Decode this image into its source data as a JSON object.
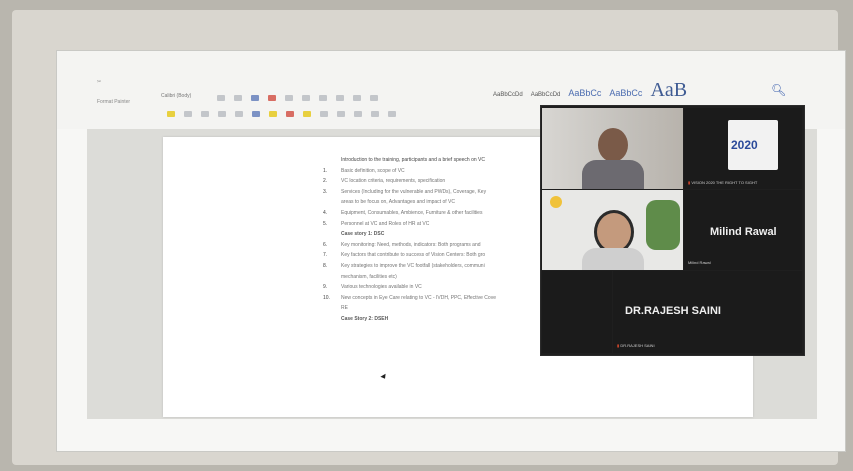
{
  "ribbon": {
    "font_name": "Calibri (Body)",
    "format_painter": "Format Painter",
    "style_gallery": [
      {
        "label": "AaBbCcDd",
        "variant": "normal"
      },
      {
        "label": "AaBbCcDd",
        "variant": "normal"
      },
      {
        "label": "AaBbCc",
        "variant": "blue"
      },
      {
        "label": "AaBbCc",
        "variant": "blue"
      },
      {
        "label": "AaB",
        "variant": "title"
      }
    ],
    "find_icon": "binoculars-icon"
  },
  "document": {
    "intro": "Introduction to the training, participants and a brief speech on VC",
    "items": [
      {
        "num": "1.",
        "text": "Basic definition, scope of VC"
      },
      {
        "num": "2.",
        "text": "VC location criteria, requirements, specification"
      },
      {
        "num": "3.",
        "text": "Services (Including for the vulnerable and PWDs), Coverage, Key"
      },
      {
        "num": "",
        "text": "areas to be focus on, Advantages and impact of VC"
      },
      {
        "num": "4.",
        "text": "Equipment, Consumables, Ambience, Furniture & other facilities"
      },
      {
        "num": "5.",
        "text": "Personnel at VC and Roles of HR at VC"
      },
      {
        "num": "",
        "text": "Case story 1: DSC",
        "bold": true
      },
      {
        "num": "6.",
        "text": "Key monitoring: Need, methods, indicators: Both programs and"
      },
      {
        "num": "7.",
        "text": "Key factors that contribute to success of Vision Centers: Both gro"
      },
      {
        "num": "8.",
        "text": "Key strategies to improve the VC footfall (stakeholders, communi"
      },
      {
        "num": "",
        "text": "mechanism, facilities etc)"
      },
      {
        "num": "9.",
        "text": "Various technologies available in VC"
      },
      {
        "num": "10.",
        "text": "New concepts in Eye Care relating to VC - IVDH, PPC, Effective Cove"
      },
      {
        "num": "",
        "text": "RE"
      },
      {
        "num": "",
        "text": "Case Story 2: DSEH",
        "bold": true
      }
    ]
  },
  "video_call": {
    "participant_1_label": "",
    "logo_tile_caption": "VISION 2020 THE RIGHT TO SIGHT",
    "logo_text": "2020",
    "participant_2_label": "",
    "milind_name": "Milind Rawal",
    "milind_small": "Milind Rawal",
    "rajesh_name": "DR.RAJESH SAINI",
    "rajesh_small": "DR.RAJESH SAINI"
  },
  "colors": {
    "accent": "#3a5fae",
    "mic_muted": "#e04a2c",
    "video_bg": "#1f1f1f"
  }
}
